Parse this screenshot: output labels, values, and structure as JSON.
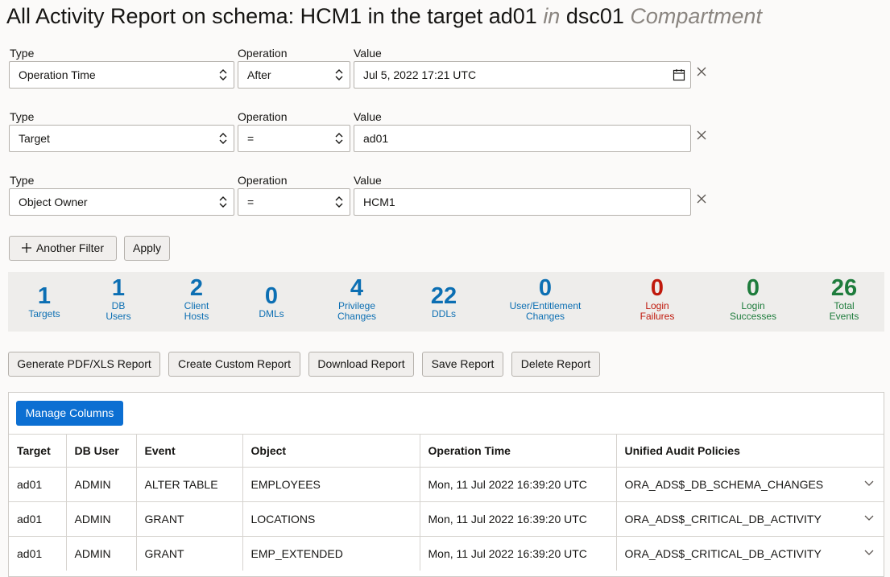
{
  "title": {
    "part1": "All Activity Report on schema: HCM1 in the target ad01 ",
    "in_word": "in",
    "part2": " dsc01 ",
    "compartment_word": "Compartment"
  },
  "filters": [
    {
      "type_label": "Type",
      "operation_label": "Operation",
      "value_label": "Value",
      "type": "Operation Time",
      "operation": "After",
      "value": "Jul 5, 2022 17:21 UTC"
    },
    {
      "type_label": "Type",
      "operation_label": "Operation",
      "value_label": "Value",
      "type": "Target",
      "operation": "=",
      "value": "ad01"
    },
    {
      "type_label": "Type",
      "operation_label": "Operation",
      "value_label": "Value",
      "type": "Object Owner",
      "operation": "=",
      "value": "HCM1"
    }
  ],
  "filter_buttons": {
    "another_filter": "Another Filter",
    "apply": "Apply"
  },
  "stats": [
    {
      "value": "1",
      "label1": "Targets",
      "label2": "",
      "color": "#0c6fb3"
    },
    {
      "value": "1",
      "label1": "DB",
      "label2": "Users",
      "color": "#0c6fb3"
    },
    {
      "value": "2",
      "label1": "Client",
      "label2": "Hosts",
      "color": "#0c6fb3"
    },
    {
      "value": "0",
      "label1": "DMLs",
      "label2": "",
      "color": "#0c6fb3"
    },
    {
      "value": "4",
      "label1": "Privilege",
      "label2": "Changes",
      "color": "#0c6fb3"
    },
    {
      "value": "22",
      "label1": "DDLs",
      "label2": "",
      "color": "#0c6fb3"
    },
    {
      "value": "0",
      "label1": "User/Entitlement",
      "label2": "Changes",
      "color": "#0c6fb3"
    },
    {
      "value": "0",
      "label1": "Login",
      "label2": "Failures",
      "color": "#c0190c"
    },
    {
      "value": "0",
      "label1": "Login",
      "label2": "Successes",
      "color": "#1e7c3c"
    },
    {
      "value": "26",
      "label1": "Total",
      "label2": "Events",
      "color": "#1e7c3c"
    }
  ],
  "actions": {
    "generate": "Generate PDF/XLS Report",
    "create_custom": "Create Custom Report",
    "download": "Download Report",
    "save": "Save Report",
    "delete": "Delete Report"
  },
  "table": {
    "manage_columns": "Manage Columns",
    "headers": [
      "Target",
      "DB User",
      "Event",
      "Object",
      "Operation Time",
      "Unified Audit Policies"
    ],
    "rows": [
      [
        "ad01",
        "ADMIN",
        "ALTER TABLE",
        "EMPLOYEES",
        "Mon, 11 Jul 2022 16:39:20 UTC",
        "ORA_ADS$_DB_SCHEMA_CHANGES"
      ],
      [
        "ad01",
        "ADMIN",
        "GRANT",
        "LOCATIONS",
        "Mon, 11 Jul 2022 16:39:20 UTC",
        "ORA_ADS$_CRITICAL_DB_ACTIVITY"
      ],
      [
        "ad01",
        "ADMIN",
        "GRANT",
        "EMP_EXTENDED",
        "Mon, 11 Jul 2022 16:39:20 UTC",
        "ORA_ADS$_CRITICAL_DB_ACTIVITY"
      ]
    ]
  },
  "icons": {
    "select": "chevron-updown-icon",
    "calendar": "calendar-icon",
    "remove": "close-icon",
    "add": "plus-icon",
    "expand": "chevron-down-icon"
  }
}
